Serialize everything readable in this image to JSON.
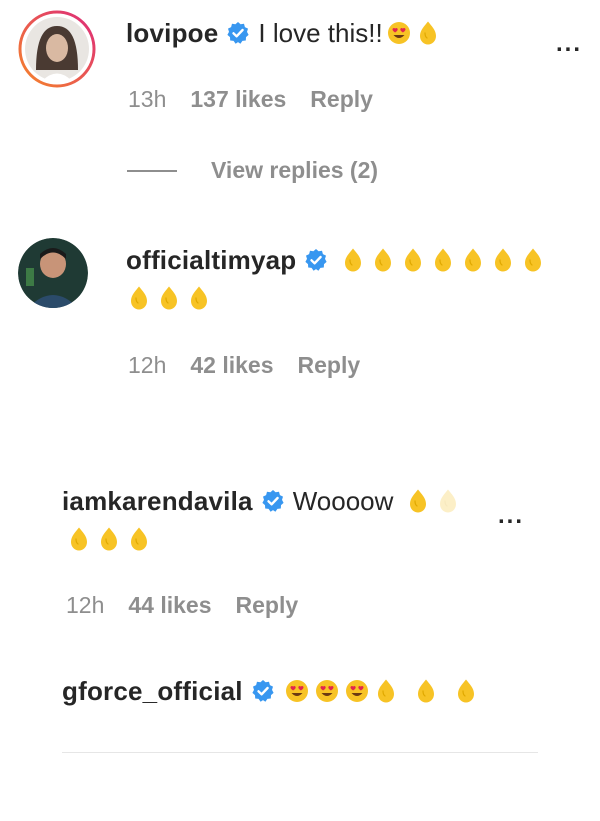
{
  "comments": [
    {
      "username": "lovipoe",
      "verified": true,
      "text": "I love this!!",
      "emojis": [
        "smiling-face-with-heart-eyes",
        "raised-hand"
      ],
      "time": "13h",
      "likes": "137 likes",
      "reply": "Reply",
      "more": "...",
      "view_replies": "View replies (2)"
    },
    {
      "username": "officialtimyap",
      "verified": true,
      "text": "",
      "emojis_line1": [
        "raised-hand",
        "raised-hand",
        "raised-hand",
        "raised-hand",
        "raised-hand",
        "raised-hand",
        "raised-hand"
      ],
      "emojis_line2": [
        "raised-hand",
        "raised-hand",
        "raised-hand"
      ],
      "time": "12h",
      "likes": "42 likes",
      "reply": "Reply"
    },
    {
      "username": "iamkarendavila",
      "verified": true,
      "text": "Woooow",
      "emojis_line1": [
        "raised-hand",
        "raised-hand"
      ],
      "emojis_line2": [
        "raised-hand",
        "raised-hand",
        "raised-hand"
      ],
      "time": "12h",
      "likes": "44 likes",
      "reply": "Reply",
      "more": "..."
    },
    {
      "username": "gforce_official",
      "verified": true,
      "text": "",
      "emojis": [
        "smiling-face-with-heart-eyes",
        "smiling-face-with-heart-eyes",
        "smiling-face-with-heart-eyes",
        "raised-hand",
        "raised-hand",
        "raised-hand"
      ]
    }
  ],
  "colors": {
    "verified": "#3897f0",
    "secondary_text": "#8e8e8e",
    "primary_text": "#262626",
    "emoji_yellow": "#f7c325",
    "story_ring_start": "#f58529",
    "story_ring_end": "#dd2a7b"
  }
}
